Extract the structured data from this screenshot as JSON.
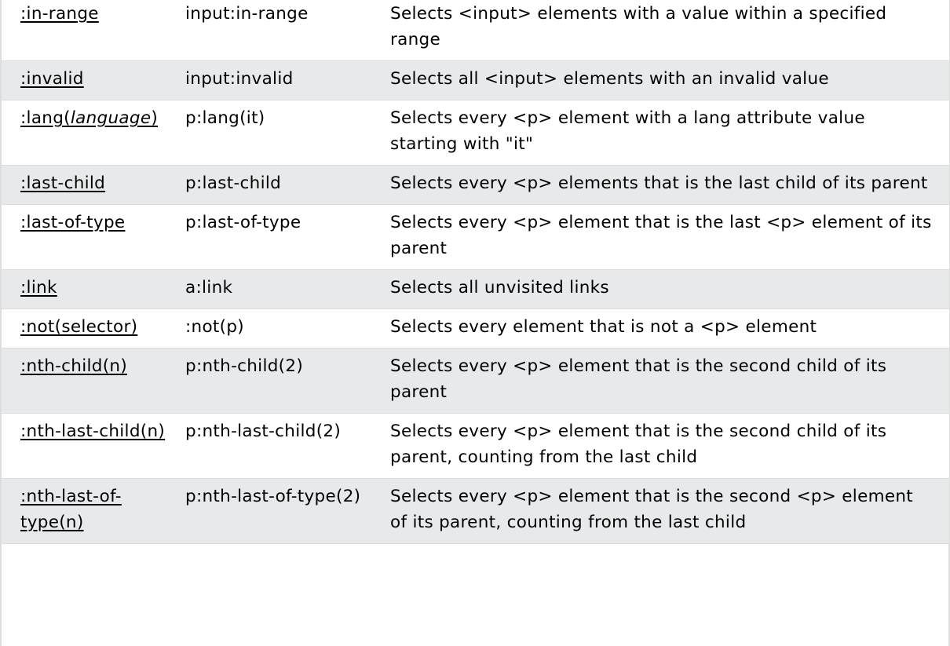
{
  "rows": [
    {
      "selector": ":in-range",
      "example": "input:in-range",
      "description": "Selects <input> elements with a value within a specified range"
    },
    {
      "selector": ":invalid",
      "example": "input:invalid",
      "description": "Selects all <input> elements with an invalid value"
    },
    {
      "selector_prefix": ":lang(",
      "selector_italic": "language",
      "selector_suffix": ")",
      "example": "p:lang(it)",
      "description": "Selects every <p> element with a lang attribute value starting with \"it\""
    },
    {
      "selector": ":last-child",
      "example": "p:last-child",
      "description": "Selects every <p> elements that is the last child of its parent"
    },
    {
      "selector": ":last-of-type",
      "example": "p:last-of-type",
      "description": "Selects every <p> element that is the last <p> element of its parent"
    },
    {
      "selector": ":link",
      "example": "a:link",
      "description": "Selects all unvisited links"
    },
    {
      "selector": ":not(selector)",
      "example": ":not(p)",
      "description": "Selects every element that is not a <p> element"
    },
    {
      "selector": ":nth-child(n)",
      "example": "p:nth-child(2)",
      "description": "Selects every <p> element that is the second child of its parent"
    },
    {
      "selector": ":nth-last-child(n)",
      "example": "p:nth-last-child(2)",
      "description": "Selects every <p> element that is the second child of its parent, counting from the last child"
    },
    {
      "selector": ":nth-last-of-type(n)",
      "example": "p:nth-last-of-type(2)",
      "description": "Selects every <p> element that is the second <p> element of its parent, counting from the last child"
    }
  ]
}
